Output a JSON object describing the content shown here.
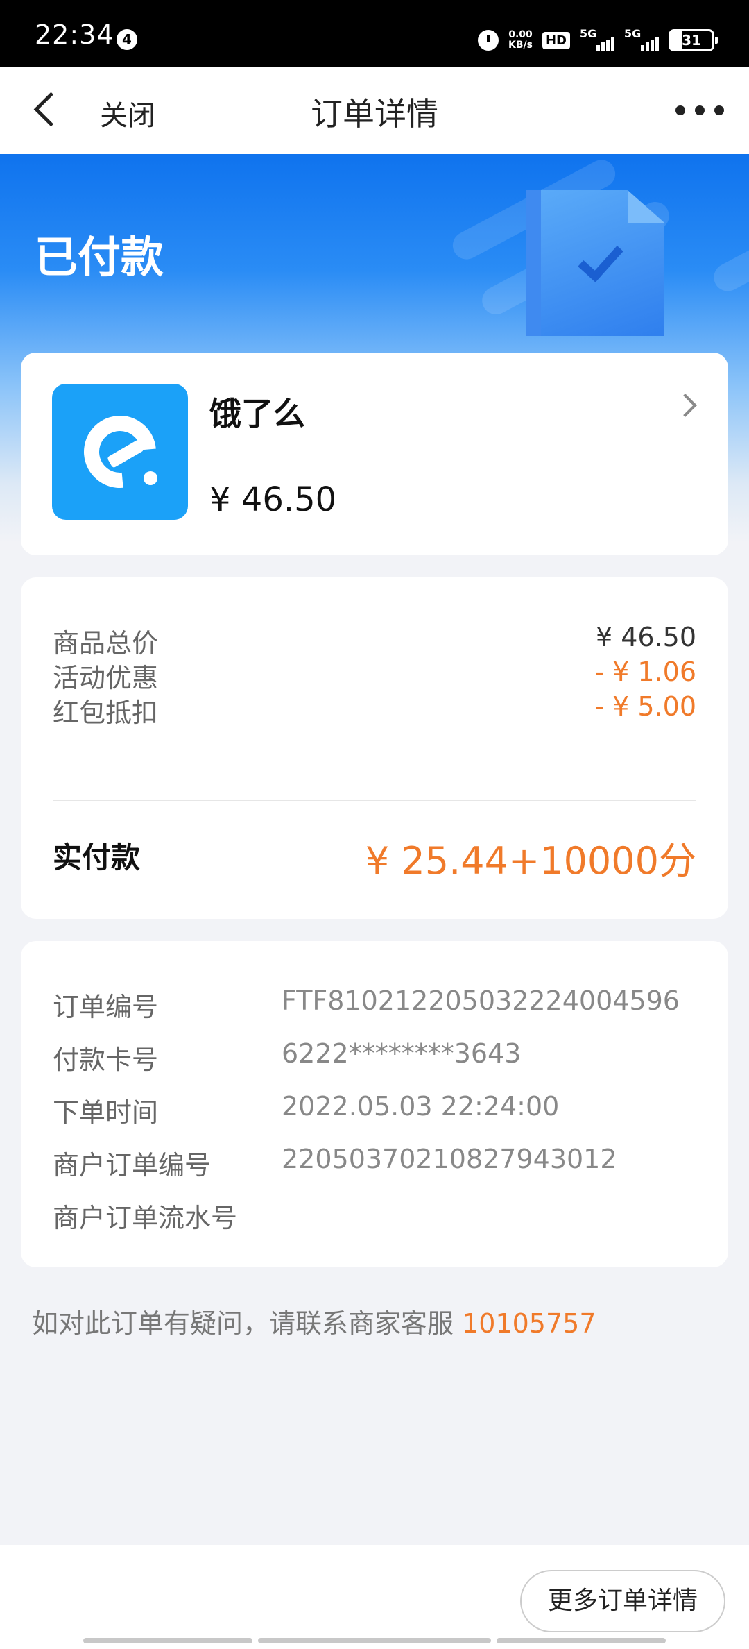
{
  "status_bar": {
    "time": "22:34",
    "notification_count": "4",
    "net_speed_value": "0.00",
    "net_speed_unit": "KB/s",
    "hd_label": "HD",
    "signal1_label": "5G",
    "signal2_label": "5G",
    "battery": "31"
  },
  "nav": {
    "close_label": "关闭",
    "title": "订单详情"
  },
  "hero": {
    "status": "已付款"
  },
  "merchant": {
    "name": "饿了么",
    "amount": "¥ 46.50"
  },
  "price": {
    "rows": [
      {
        "label": "商品总价",
        "value": "¥ 46.50"
      },
      {
        "label": "活动优惠",
        "value": "- ¥ 1.06"
      },
      {
        "label": "红包抵扣",
        "value": "- ¥ 5.00"
      }
    ],
    "paid_label": "实付款",
    "paid_value": "¥ 25.44+10000分"
  },
  "info": {
    "rows": [
      {
        "label": "订单编号",
        "value": "FTF810212205032224004596"
      },
      {
        "label": "付款卡号",
        "value": "6222********3643"
      },
      {
        "label": "下单时间",
        "value": "2022.05.03 22:24:00"
      },
      {
        "label": "商户订单编号",
        "value": "220503702108279430​12"
      },
      {
        "label": "商户订单流水号",
        "value": ""
      }
    ]
  },
  "contact": {
    "text": "如对此订单有疑问，请联系商家客服 ",
    "phone": "10105757"
  },
  "bottom": {
    "more_label": "更多订单详情"
  },
  "colors": {
    "accent_orange": "#f07a2a",
    "hero_blue": "#0f73ee",
    "logo_blue": "#1ba1f8"
  }
}
